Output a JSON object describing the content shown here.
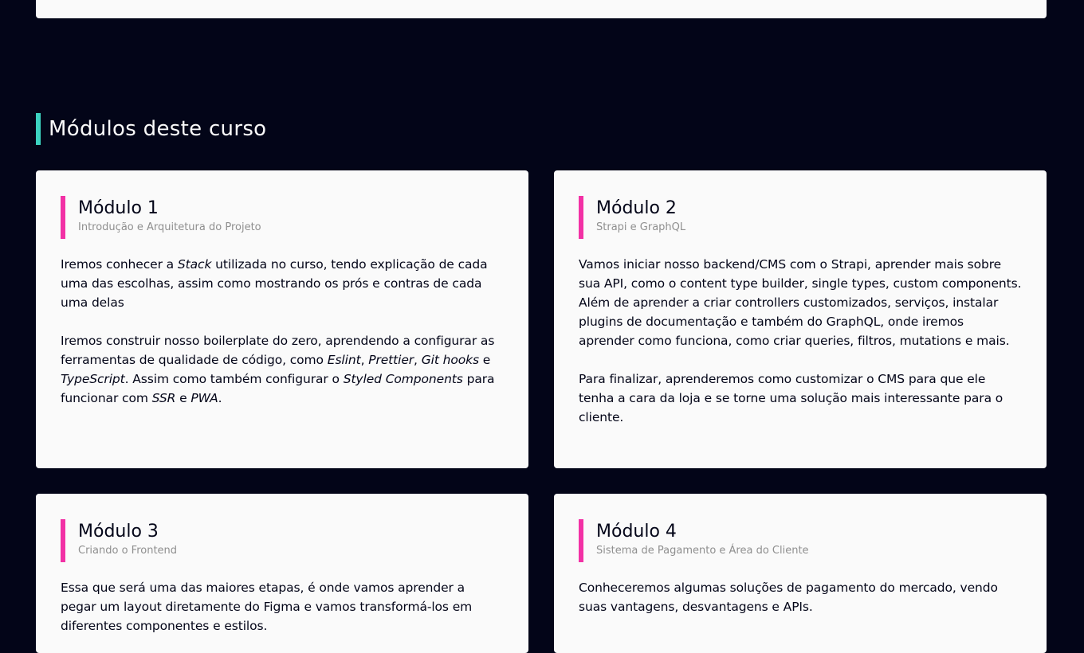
{
  "section": {
    "title": "Módulos deste curso"
  },
  "modules": [
    {
      "title": "Módulo 1",
      "subtitle": "Introdução e Arquitetura do Projeto",
      "p1": {
        "t1": "Iremos conhecer a ",
        "i1": "Stack",
        "t2": " utilizada no curso, tendo explicação de cada uma das escolhas, assim como mostrando os prós e contras de cada uma delas"
      },
      "p2": {
        "t1": "Iremos construir nosso boilerplate do zero, aprendendo a configurar as ferramentas de qualidade de código, como ",
        "i1": "Eslint",
        "t2": ", ",
        "i2": "Prettier",
        "t3": ", ",
        "i3": "Git hooks",
        "t4": " e ",
        "i4": "TypeScript",
        "t5": ". Assim como também configurar o ",
        "i5": "Styled Components",
        "t6": " para funcionar com ",
        "i6": "SSR",
        "t7": " e ",
        "i7": "PWA",
        "t8": "."
      }
    },
    {
      "title": "Módulo 2",
      "subtitle": "Strapi e GraphQL",
      "p1": "Vamos iniciar nosso backend/CMS com o Strapi, aprender mais sobre sua API, como o content type builder, single types, custom components. Além de aprender a criar controllers customizados, serviços, instalar plugins de documentação e também do GraphQL, onde iremos aprender como funciona, como criar queries, filtros, mutations e mais.",
      "p2": "Para finalizar, aprenderemos como customizar o CMS para que ele tenha a cara da loja e se torne uma solução mais interessante para o cliente."
    },
    {
      "title": "Módulo 3",
      "subtitle": "Criando o Frontend",
      "p1": "Essa que será uma das maiores etapas, é onde vamos aprender a pegar um layout diretamente do Figma e vamos transformá-los em diferentes componentes e estilos."
    },
    {
      "title": "Módulo 4",
      "subtitle": "Sistema de Pagamento e Área do Cliente",
      "p1": "Conheceremos algumas soluções de pagamento do mercado, vendo suas vantagens, desvantagens e APIs."
    }
  ],
  "colors": {
    "background": "#030518",
    "card": "#fafafa",
    "section_accent": "#3cd3c1",
    "module_accent": "#f231a5",
    "subtitle": "#8f8f8f"
  }
}
